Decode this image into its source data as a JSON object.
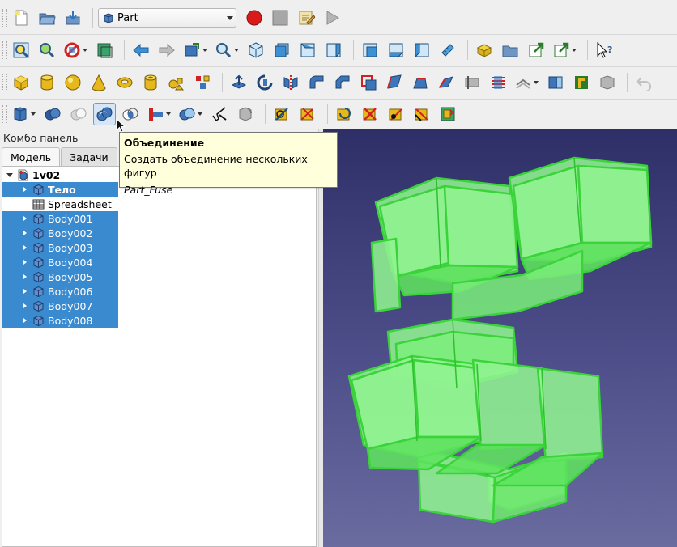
{
  "workbench": {
    "selected": "Part"
  },
  "combo_panel": {
    "title": "Комбо панель",
    "tabs": [
      {
        "label": "Модель"
      },
      {
        "label": "Задачи"
      }
    ]
  },
  "tree": {
    "root": "1v02",
    "items": [
      {
        "label": "Тело",
        "selected": true,
        "bold": true
      },
      {
        "label": "Spreadsheet",
        "selected": false
      },
      {
        "label": "Body001",
        "selected": true
      },
      {
        "label": "Body002",
        "selected": true
      },
      {
        "label": "Body003",
        "selected": true
      },
      {
        "label": "Body004",
        "selected": true
      },
      {
        "label": "Body005",
        "selected": true
      },
      {
        "label": "Body006",
        "selected": true
      },
      {
        "label": "Body007",
        "selected": true
      },
      {
        "label": "Body008",
        "selected": true
      }
    ]
  },
  "tooltip": {
    "title": "Объединение",
    "description": "Создать объединение нескольких фигур",
    "command": "Part_Fuse"
  },
  "colors": {
    "selection": "#3a8ad0",
    "shape_fill": "#8ff28f",
    "shape_edge": "#3ad43a",
    "view_bg_top": "#2f2f68",
    "view_bg_bottom": "#6a6b9f",
    "tooltip_bg": "#ffffdc"
  },
  "icons": {
    "file_toolbar": [
      "new-file-icon",
      "open-file-icon",
      "save-file-icon"
    ],
    "macro_toolbar": [
      "record-macro-icon",
      "stop-macro-icon",
      "edit-macro-icon",
      "run-macro-icon"
    ],
    "view_toolbar": [
      "fit-all-icon",
      "fit-selection-icon",
      "draw-style-icon",
      "bounding-box-icon",
      "back-icon",
      "forward-icon",
      "workbench-nav-icon",
      "std-zoom-icon",
      "isometric-icon",
      "front-view-icon",
      "top-view-icon",
      "right-view-icon",
      "rear-view-icon",
      "bottom-view-icon",
      "left-view-icon",
      "measure-icon",
      "part-icon",
      "group-icon",
      "link-icon",
      "link-actions-icon",
      "whats-this-icon"
    ],
    "part_primitives": [
      "box-icon",
      "cylinder-icon",
      "sphere-icon",
      "cone-icon",
      "torus-icon",
      "tube-icon",
      "primitives-icon",
      "shape-builder-icon",
      "extrude-icon",
      "revolve-icon",
      "mirror-icon",
      "fillet-icon",
      "chamfer-icon",
      "make-face-icon",
      "ruled-surface-icon",
      "loft-icon",
      "sweep-icon",
      "section-icon",
      "cross-sections-icon",
      "offset-icon",
      "thickness-icon",
      "projection-icon",
      "color-icon",
      "undo-icon"
    ],
    "part_boolean": [
      "compound-icon",
      "boolean-icon",
      "cut-icon",
      "fuse-icon",
      "common-icon",
      "join-icon",
      "split-icon",
      "check-geometry-icon",
      "defeaturing-icon",
      "measure-linear-icon",
      "measure-angular-icon",
      "measure-refresh-icon",
      "measure-clear-icon",
      "measure-toggle-all-icon",
      "measure-toggle-3d-icon",
      "measure-toggle-delta-icon"
    ]
  }
}
